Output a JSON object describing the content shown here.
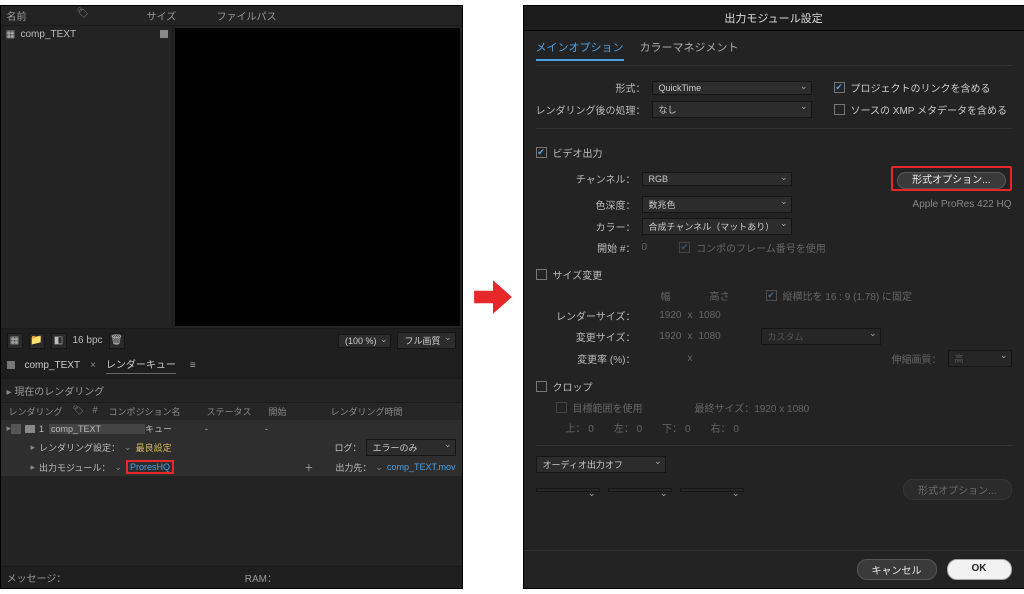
{
  "left": {
    "header": {
      "name": "名前",
      "tag": "",
      "size": "サイズ",
      "filepath": "ファイルパス"
    },
    "project": {
      "item": "comp_TEXT"
    },
    "footer1": {
      "bpc": "16 bpc",
      "zoom": "(100 %)",
      "quality": "フル画質"
    },
    "tabs": {
      "t1": "comp_TEXT",
      "t2": "レンダーキュー"
    },
    "rq": {
      "current": "現在のレンダリング",
      "cols": {
        "c1": "レンダリング",
        "c2": "",
        "c3": "#",
        "c4": "コンポジション名",
        "c5": "ステータス",
        "c6": "開始",
        "c7": "レンダリング時間"
      },
      "item": {
        "num": "1",
        "name": "comp_TEXT",
        "status": "キュー",
        "dash1": "-",
        "dash2": "-"
      },
      "row_rs_label": "レンダリング設定：",
      "row_rs_value": "最良設定",
      "log_label": "ログ：",
      "log_value": "エラーのみ",
      "row_om_label": "出力モジュール：",
      "row_om_value": "ProresHQ",
      "plus": "＋",
      "dest_label": "出力先：",
      "dest_value": "comp_TEXT.mov"
    },
    "msg": {
      "label": "メッセージ：",
      "ram": "RAM："
    }
  },
  "right": {
    "title": "出力モジュール設定",
    "tabs": {
      "main": "メインオプション",
      "color": "カラーマネジメント"
    },
    "format_label": "形式：",
    "format_value": "QuickTime",
    "cb_project_link": "プロジェクトのリンクを含める",
    "postrender_label": "レンダリング後の処理：",
    "postrender_value": "なし",
    "cb_src_xmp": "ソースの XMP メタデータを含める",
    "video_out": "ビデオ出力",
    "channel_label": "チャンネル：",
    "channel_value": "RGB",
    "fmtopt": "形式オプション...",
    "codec_info": "Apple ProRes 422 HQ",
    "depth_label": "色深度：",
    "depth_value": "数兆色",
    "color_label": "カラー：",
    "color_value": "合成チャンネル（マットあり）",
    "startnum_label": "開始 #：",
    "startnum_value": "0",
    "comp_frame": "コンポのフレーム番号を使用",
    "resize": "サイズ変更",
    "resize_hdr_w": "幅",
    "resize_hdr_h": "高さ",
    "lock_aspect": "縦横比を 16 : 9 (1.78) に固定",
    "render_size_label": "レンダーサイズ：",
    "rs_w": "1920",
    "rs_h": "1080",
    "x": "x",
    "resize_size_label": "変更サイズ：",
    "rz_w": "1920",
    "rz_h": "1080",
    "custom": "カスタム",
    "resize_pct_label": "変更率 (%)：",
    "quality_label": "伸縮画質：",
    "quality_value": "高",
    "crop": "クロップ",
    "use_roi": "目標範囲を使用",
    "final_size": "最終サイズ：1920 x 1080",
    "crop_t": "上：",
    "crop_l": "左：",
    "crop_b": "下：",
    "crop_r": "右：",
    "zero": "0",
    "audio_out": "オーディオ出力オフ",
    "audio_fmtopt": "形式オプション...",
    "cancel": "キャンセル",
    "ok": "OK"
  }
}
